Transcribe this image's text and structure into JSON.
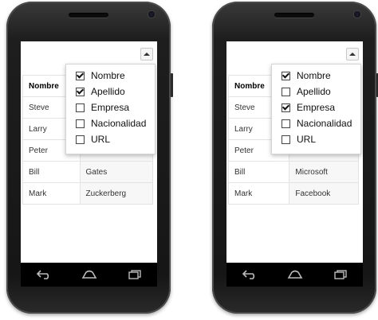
{
  "phones": [
    {
      "table": {
        "header": [
          "Nombre"
        ],
        "rows": [
          {
            "c1": "Steve",
            "c2": ""
          },
          {
            "c1": "Larry",
            "c2": ""
          },
          {
            "c1": "Peter",
            "c2": ""
          },
          {
            "c1": "Bill",
            "c2": "Gates"
          },
          {
            "c1": "Mark",
            "c2": "Zuckerberg"
          }
        ]
      },
      "menu": [
        {
          "label": "Nombre",
          "checked": true
        },
        {
          "label": "Apellido",
          "checked": true
        },
        {
          "label": "Empresa",
          "checked": false
        },
        {
          "label": "Nacionalidad",
          "checked": false
        },
        {
          "label": "URL",
          "checked": false
        }
      ]
    },
    {
      "table": {
        "header": [
          "Nombre"
        ],
        "rows": [
          {
            "c1": "Steve",
            "c2": ""
          },
          {
            "c1": "Larry",
            "c2": ""
          },
          {
            "c1": "Peter",
            "c2": ""
          },
          {
            "c1": "Bill",
            "c2": "Microsoft"
          },
          {
            "c1": "Mark",
            "c2": "Facebook"
          }
        ]
      },
      "menu": [
        {
          "label": "Nombre",
          "checked": true
        },
        {
          "label": "Apellido",
          "checked": false
        },
        {
          "label": "Empresa",
          "checked": true
        },
        {
          "label": "Nacionalidad",
          "checked": false
        },
        {
          "label": "URL",
          "checked": false
        }
      ]
    }
  ],
  "icons": {
    "toggle": "chevron-up-icon",
    "back": "back-icon",
    "home": "home-icon",
    "recents": "recent-apps-icon"
  }
}
